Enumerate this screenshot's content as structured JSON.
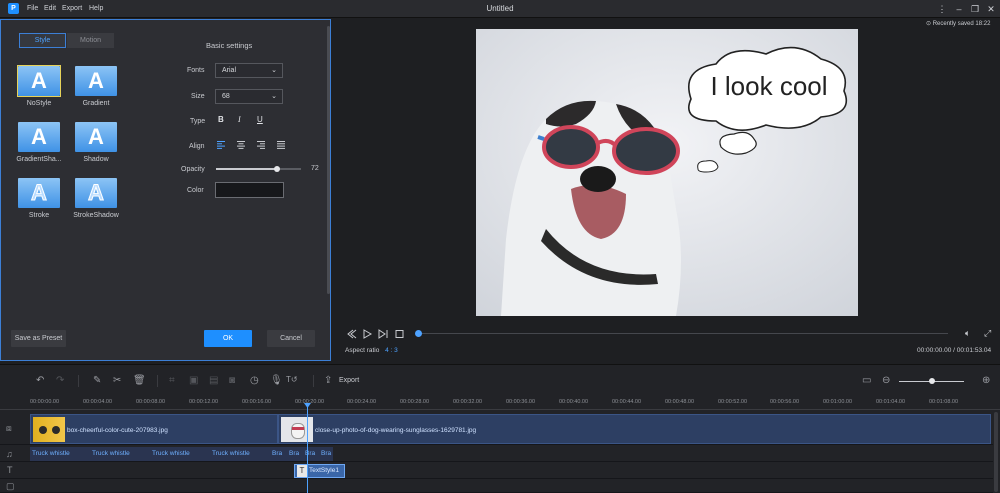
{
  "app": {
    "logo": "P",
    "title": "Untitled",
    "saved": "Recently saved 18:22"
  },
  "menu": [
    "File",
    "Edit",
    "Export",
    "Help"
  ],
  "window_icons": [
    "more-icon",
    "minimize-icon",
    "restore-icon",
    "close-icon"
  ],
  "panel": {
    "tabs": [
      "Style",
      "Motion"
    ],
    "heading": "Basic settings",
    "styles": [
      "NoStyle",
      "Gradient",
      "GradientSha...",
      "Shadow",
      "Stroke",
      "StrokeShadow"
    ],
    "tile_letter": "A",
    "fonts_label": "Fonts",
    "fonts_value": "Arial",
    "size_label": "Size",
    "size_value": "68",
    "type_label": "Type",
    "type_buttons": [
      "B",
      "I",
      "U"
    ],
    "align_label": "Align",
    "opacity_label": "Opacity",
    "opacity_value": "72",
    "color_label": "Color",
    "save_preset": "Save as Preset",
    "ok": "OK",
    "cancel": "Cancel"
  },
  "preview": {
    "bubble_text": "I look cool",
    "aspect_label": "Aspect ratio",
    "aspect_value": "4 : 3",
    "time": "00:00:00.00 / 00:01:53.04"
  },
  "toolbar": {
    "export": "Export"
  },
  "ruler": [
    "00:00:00.00",
    "00:00:04.00",
    "00:00:08.00",
    "00:00:12.00",
    "00:00:16.00",
    "00:00:20.00",
    "00:00:24.00",
    "00:00:28.00",
    "00:00:32.00",
    "00:00:36.00",
    "00:00:40.00",
    "00:00:44.00",
    "00:00:48.00",
    "00:00:52.00",
    "00:00:56.00",
    "00:01:00.00",
    "00:01:04.00",
    "00:01:08.00"
  ],
  "tracks": {
    "clip1": "box-cheerful-color-cute-207983.jpg",
    "clip2": "close-up-photo-of-dog-wearing-sunglasses-1629781.jpg",
    "motions": [
      "Truck whistle",
      "Truck whistle",
      "Truck whistle",
      "Truck whistle",
      "Bra",
      "Bra",
      "Bra",
      "Bra"
    ],
    "text_clip": "TextStyle1",
    "text_icon": "T"
  },
  "colors": {
    "accent": "#1e8fff",
    "panel_border": "#3c7fd6"
  }
}
